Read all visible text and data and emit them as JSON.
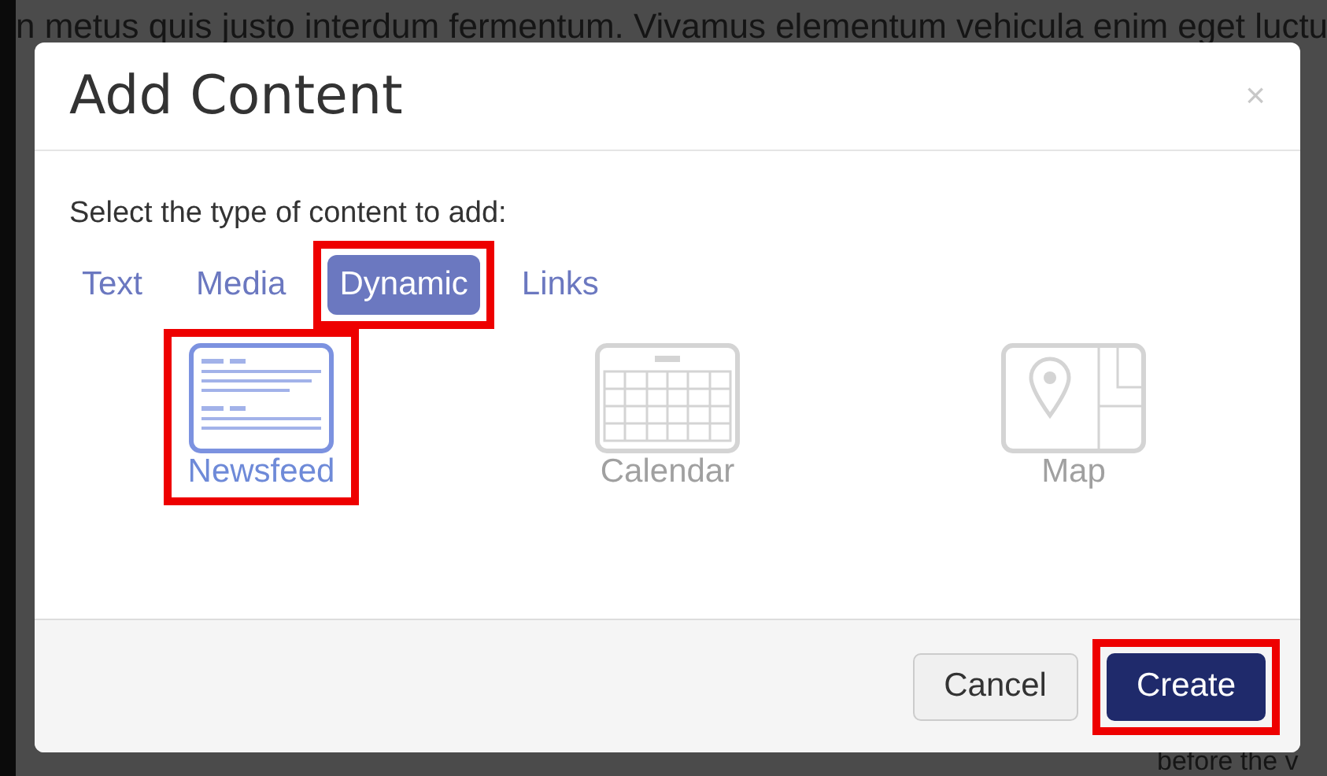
{
  "background": {
    "top_text": "n metus quis justo interdum fermentum. Vivamus elementum vehicula enim eget luctu",
    "bottom_text": "before the v"
  },
  "dialog": {
    "title": "Add Content",
    "close": "×",
    "prompt": "Select the type of content to add:",
    "tabs": [
      {
        "label": "Text",
        "selected": false,
        "highlighted": false
      },
      {
        "label": "Media",
        "selected": false,
        "highlighted": false
      },
      {
        "label": "Dynamic",
        "selected": true,
        "highlighted": true
      },
      {
        "label": "Links",
        "selected": false,
        "highlighted": false
      }
    ],
    "items": [
      {
        "kind": "newsfeed",
        "label": "Newsfeed",
        "selected": true,
        "highlighted": true
      },
      {
        "kind": "calendar",
        "label": "Calendar",
        "selected": false,
        "highlighted": false
      },
      {
        "kind": "map",
        "label": "Map",
        "selected": false,
        "highlighted": false
      }
    ],
    "buttons": [
      {
        "kind": "secondary",
        "label": "Cancel",
        "highlighted": false
      },
      {
        "kind": "primary",
        "label": "Create",
        "highlighted": true
      }
    ]
  }
}
